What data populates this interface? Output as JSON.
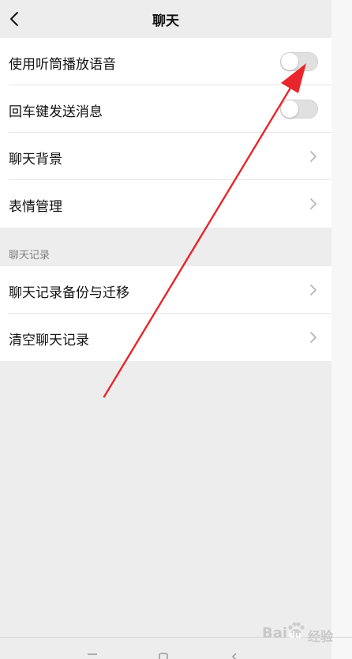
{
  "header": {
    "title": "聊天"
  },
  "settings_group_1": {
    "items": [
      {
        "label": "使用听筒播放语音",
        "control": "toggle",
        "enabled": false
      },
      {
        "label": "回车键发送消息",
        "control": "toggle",
        "enabled": false
      },
      {
        "label": "聊天背景",
        "control": "chevron"
      },
      {
        "label": "表情管理",
        "control": "chevron"
      }
    ]
  },
  "section_chat_history": {
    "title": "聊天记录",
    "items": [
      {
        "label": "聊天记录备份与迁移",
        "control": "chevron"
      },
      {
        "label": "清空聊天记录",
        "control": "chevron"
      }
    ]
  },
  "annotation": {
    "arrow_color": "#e8262b"
  },
  "watermark": {
    "brand": "Bai",
    "brand_suffix": "du",
    "sub": "经验"
  },
  "colors": {
    "background": "#ededed",
    "row_background": "#ffffff",
    "toggle_off": "#e0e0e0",
    "section_label": "#808080"
  }
}
